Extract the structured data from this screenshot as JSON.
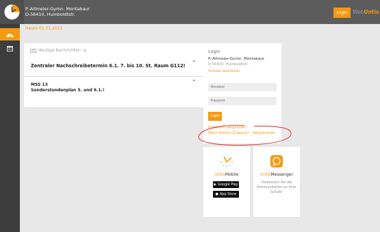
{
  "header": {
    "school_line1": "P.-Altmeier-Gymn. Montabaur",
    "school_line2": "D-56410, Humboldtstr.",
    "login_label": "Login",
    "brand_prefix": "Web",
    "brand_suffix": "Untis"
  },
  "nav": {
    "items": [
      {
        "icon": "dashboard-icon",
        "active": true
      },
      {
        "icon": "calendar-icon",
        "active": false
      }
    ]
  },
  "date_text": "Heute 05.01.2021",
  "news": {
    "header": "Heutige Nachrichten",
    "items": [
      {
        "title": "Zentraler Nachschreibetermin 6.1. 7. bis 10. St. Raum G112!"
      },
      {
        "title_line1": "MSS 13",
        "title_line2": "Sonderstundenplan 5. und 6.1.!"
      }
    ]
  },
  "login": {
    "title": "Login",
    "school_name": "P.-Altmeier-Gymn. Montabaur",
    "school_address": "D-56410, Humboldtstr.",
    "change_school": "Schule wechseln",
    "username_placeholder": "Benutzer",
    "password_placeholder": "Passwort",
    "login_button": "Login",
    "forgot_password": "Passwort vergessen?",
    "no_access": "Noch keinen Zugang? - Registrieren"
  },
  "apps": {
    "mobile": {
      "name_prefix": "Untis",
      "name_suffix": "Mobile",
      "google_play": "Google Play",
      "app_store": "App Store"
    },
    "messenger": {
      "name_prefix": "Untis",
      "name_suffix": "Messenger",
      "description": "Verbessern Sie die Kommunikation an Ihrer Schule!"
    }
  },
  "colors": {
    "accent": "#f49a10",
    "topbar": "#5c5c5c",
    "sidebar": "#3d3d3d",
    "annotation": "#d9262b"
  }
}
